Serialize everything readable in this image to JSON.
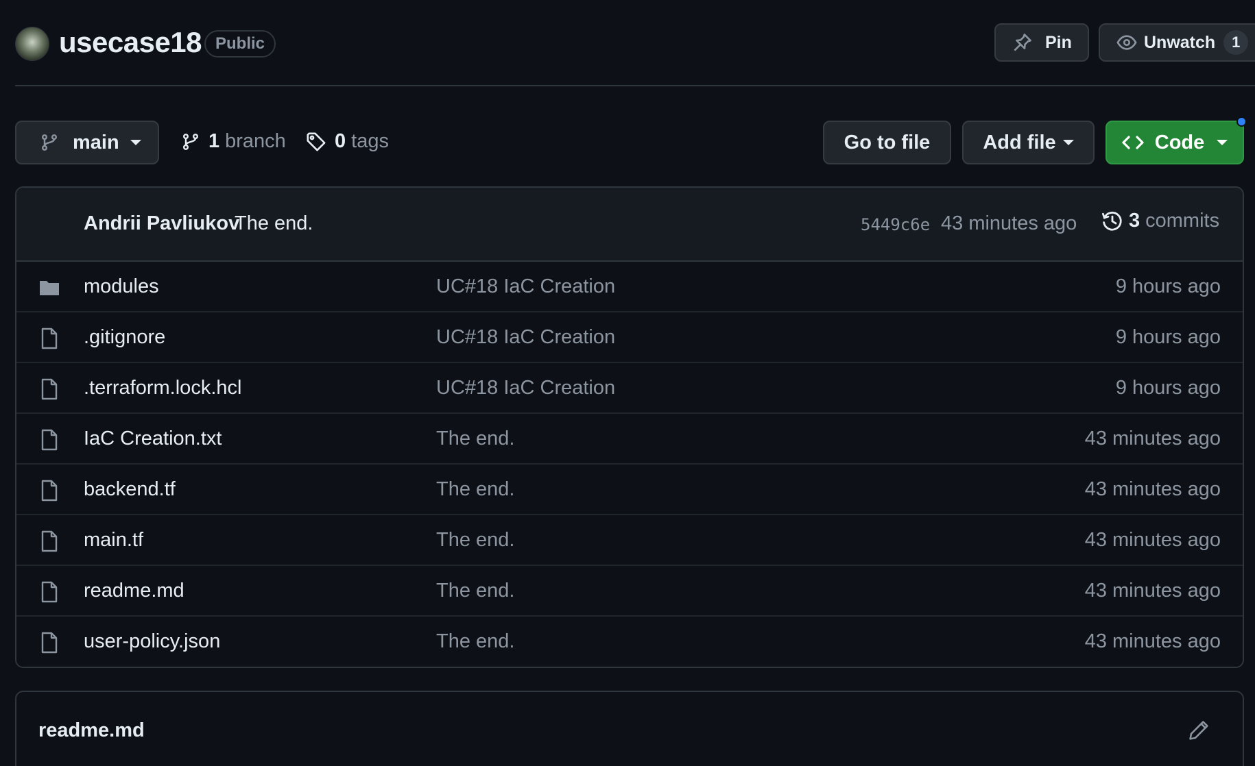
{
  "repo": {
    "name": "usecase18",
    "visibility": "Public",
    "pin_label": "Pin",
    "watch_label": "Unwatch",
    "watch_count": "1"
  },
  "branch_bar": {
    "current_branch": "main",
    "branch_count": "1",
    "branch_label": "branch",
    "tag_count": "0",
    "tag_label": "tags",
    "go_to_file": "Go to file",
    "add_file": "Add file",
    "code": "Code"
  },
  "latest_commit": {
    "author": "Andrii Pavliukov",
    "message": "The end.",
    "sha": "5449c6e",
    "time": "43 minutes ago",
    "commit_count": "3",
    "commits_label": "commits"
  },
  "files": [
    {
      "name": "modules",
      "type": "folder",
      "icon": "folder-icon",
      "commit": "UC#18 IaC Creation",
      "time": "9 hours ago"
    },
    {
      "name": ".gitignore",
      "type": "file",
      "icon": "file-icon",
      "commit": "UC#18 IaC Creation",
      "time": "9 hours ago"
    },
    {
      "name": ".terraform.lock.hcl",
      "type": "file",
      "icon": "file-icon",
      "commit": "UC#18 IaC Creation",
      "time": "9 hours ago"
    },
    {
      "name": "IaC Creation.txt",
      "type": "file",
      "icon": "file-icon",
      "commit": "The end.",
      "time": "43 minutes ago"
    },
    {
      "name": "backend.tf",
      "type": "file",
      "icon": "file-icon",
      "commit": "The end.",
      "time": "43 minutes ago"
    },
    {
      "name": "main.tf",
      "type": "file",
      "icon": "file-icon",
      "commit": "The end.",
      "time": "43 minutes ago"
    },
    {
      "name": "readme.md",
      "type": "file",
      "icon": "file-icon",
      "commit": "The end.",
      "time": "43 minutes ago"
    },
    {
      "name": "user-policy.json",
      "type": "file",
      "icon": "file-icon",
      "commit": "The end.",
      "time": "43 minutes ago"
    }
  ],
  "readme": {
    "title": "readme.md"
  },
  "colors": {
    "background": "#0d1117",
    "code_button": "#238636",
    "notification_dot": "#2f81f7",
    "muted_text": "#8d96a0"
  }
}
